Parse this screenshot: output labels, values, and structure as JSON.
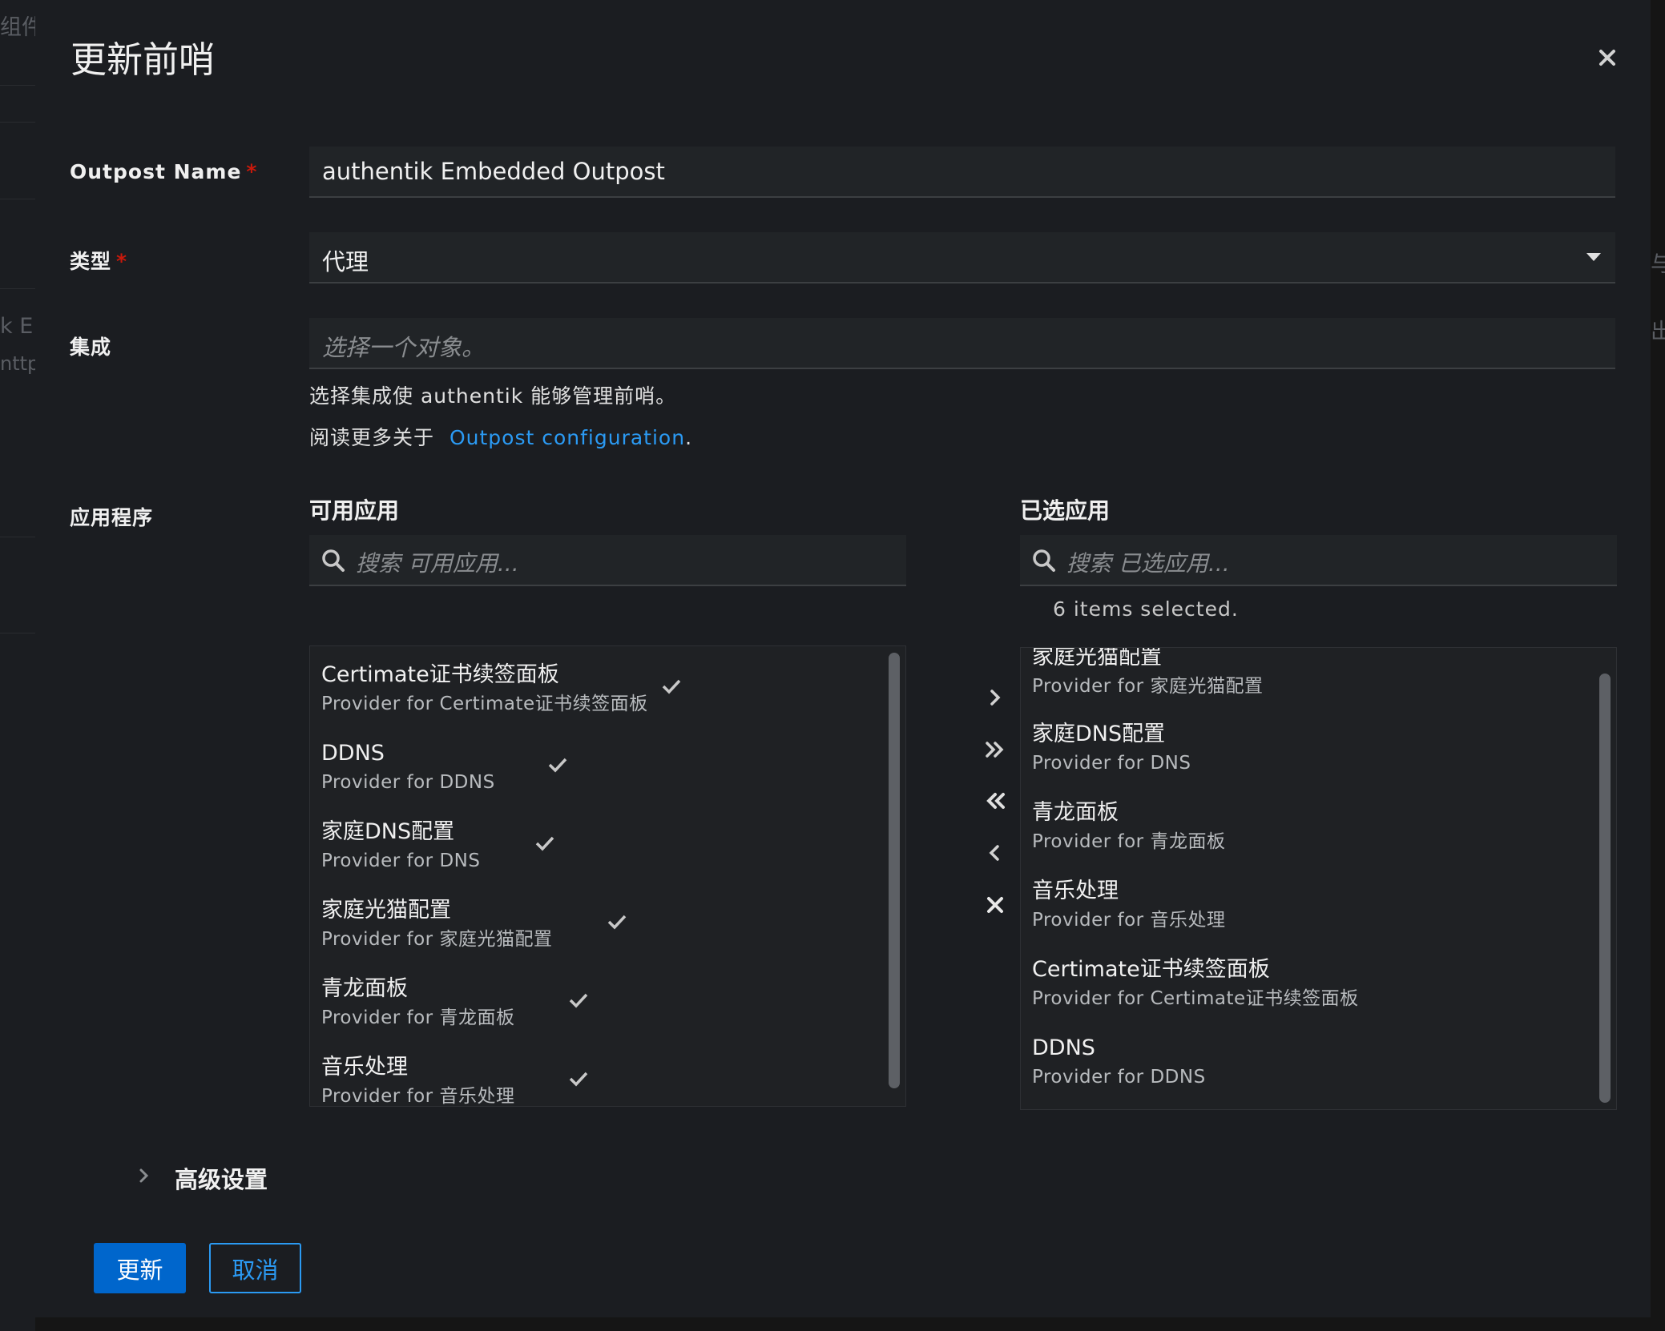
{
  "background": {
    "texts": [
      "组件",
      "k E",
      "nttp",
      "与",
      "出"
    ]
  },
  "modal": {
    "title": "更新前哨",
    "close_icon": "close-icon"
  },
  "form": {
    "outpost_name": {
      "label": "Outpost Name",
      "required_mark": "*",
      "value": "authentik Embedded Outpost"
    },
    "type": {
      "label": "类型",
      "required_mark": "*",
      "selected": "代理"
    },
    "integration": {
      "label": "集成",
      "placeholder": "选择一个对象。",
      "helper": "选择集成使 authentik 能够管理前哨。",
      "read_more_prefix": "阅读更多关于",
      "read_more_link": "Outpost configuration",
      "read_more_suffix": "."
    },
    "applications": {
      "label": "应用程序",
      "available": {
        "title": "可用应用",
        "search_placeholder": "搜索 可用应用...",
        "items": [
          {
            "title": "Certimate证书续签面板",
            "desc": "Provider for Certimate证书续签面板",
            "checked": true
          },
          {
            "title": "DDNS",
            "desc": "Provider for DDNS",
            "checked": true
          },
          {
            "title": "家庭DNS配置",
            "desc": "Provider for DNS",
            "checked": true
          },
          {
            "title": "家庭光猫配置",
            "desc": "Provider for 家庭光猫配置",
            "checked": true
          },
          {
            "title": "青龙面板",
            "desc": "Provider for 青龙面板",
            "checked": true
          },
          {
            "title": "音乐处理",
            "desc": "Provider for 音乐处理",
            "checked": true
          }
        ]
      },
      "selected": {
        "title": "已选应用",
        "search_placeholder": "搜索 已选应用...",
        "status": "6 items selected.",
        "items": [
          {
            "title": "家庭光猫配置",
            "desc": "Provider for 家庭光猫配置"
          },
          {
            "title": "家庭DNS配置",
            "desc": "Provider for DNS"
          },
          {
            "title": "青龙面板",
            "desc": "Provider for 青龙面板"
          },
          {
            "title": "音乐处理",
            "desc": "Provider for 音乐处理"
          },
          {
            "title": "Certimate证书续签面板",
            "desc": "Provider for Certimate证书续签面板"
          },
          {
            "title": "DDNS",
            "desc": "Provider for DDNS"
          }
        ]
      },
      "controls": [
        "add-selected-icon",
        "add-all-icon",
        "remove-all-icon",
        "remove-selected-icon",
        "clear-icon"
      ]
    },
    "advanced": {
      "label": "高级设置"
    }
  },
  "actions": {
    "update": "更新",
    "cancel": "取消"
  },
  "colors": {
    "primary": "#0066cc",
    "link": "#2b9af3",
    "required": "#c9190b",
    "surface": "#1b1d21"
  }
}
